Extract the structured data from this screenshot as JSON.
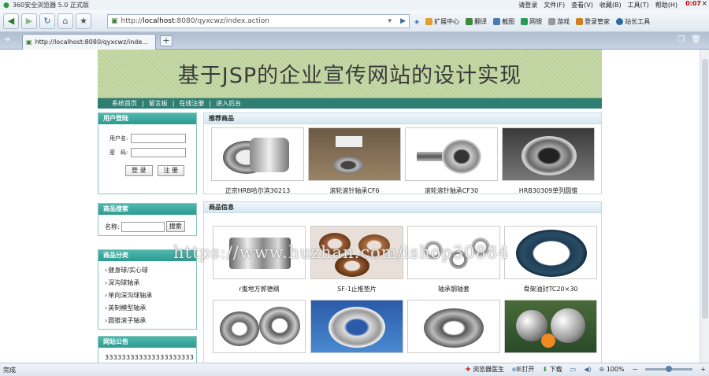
{
  "window": {
    "app_title": "360安全浏览器 5.0 正式版",
    "menu": [
      "请登录",
      "文件(F)",
      "查看(V)",
      "收藏(B)",
      "工具(T)",
      "帮助(H)"
    ],
    "clock": "0:07",
    "close": "×"
  },
  "toolbar": {
    "address_prefix": "http://",
    "address_host": "localhost",
    "address_rest": ":8080/qyxcwz/index.action",
    "tools": [
      "扩展中心",
      "翻译",
      "截图",
      "网银",
      "游戏",
      "登录管家",
      "站长工具"
    ]
  },
  "tabs": {
    "active_title": "http://localhost:8080/qyxcwz/inde..."
  },
  "page": {
    "banner_title": "基于JSP的企业宣传网站的设计实现",
    "nav": [
      "系统首页",
      "留言板",
      "在线注册",
      "进入后台"
    ],
    "nav_sep": "|",
    "login": {
      "title": "用户登陆",
      "username_label": "用户名:",
      "password_label": "密　码:",
      "login_button": "登 录",
      "register_button": "注 册"
    },
    "search": {
      "title": "商品搜索",
      "name_label": "名称:",
      "button": "搜索"
    },
    "categories": {
      "title": "商品分类",
      "items": [
        "健身球/实心球",
        "深沟球轴承",
        "单向深沟球轴承",
        "英制模型轴承",
        "圆锥滚子轴承"
      ]
    },
    "notice": {
      "title": "网站公告",
      "text": "333333333333333333333"
    },
    "recommended": {
      "title": "推荐商品",
      "items": [
        {
          "caption": "正宗HRB哈尔滨30213"
        },
        {
          "caption": "滚轮滚针轴承CF6"
        },
        {
          "caption": "滚轮滚针轴承CF30"
        },
        {
          "caption": "HRB30309单列圆锥"
        }
      ]
    },
    "products": {
      "title": "商品信息",
      "items": [
        {
          "caption": "r嵬地方郭德纲"
        },
        {
          "caption": "SF-1止推垫片"
        },
        {
          "caption": "轴承钢轴套"
        },
        {
          "caption": "骨架油封TC20×30"
        },
        {
          "caption": ""
        },
        {
          "caption": ""
        },
        {
          "caption": ""
        },
        {
          "caption": ""
        }
      ]
    },
    "watermark": "https://www.huzhan.com/ishop30884"
  },
  "status": {
    "left": "完成",
    "doctor": "浏览器医生",
    "ie_open": "IE打开",
    "download": "下载",
    "zoom": "100%"
  }
}
